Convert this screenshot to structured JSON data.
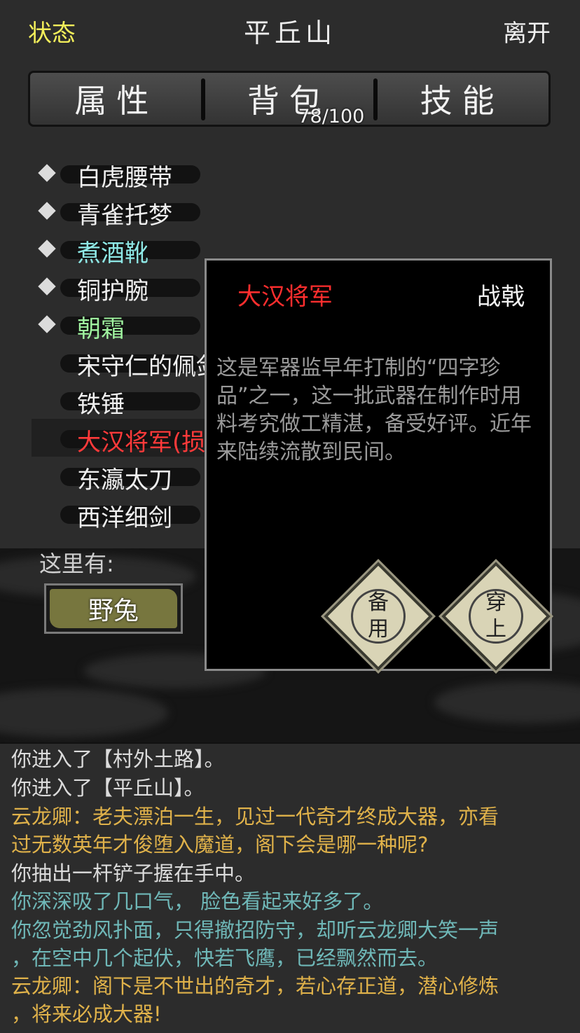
{
  "header": {
    "status_label": "状态",
    "title": "平丘山",
    "leave_label": "离开"
  },
  "tabs": [
    {
      "label": "属性",
      "count": ""
    },
    {
      "label": "背包",
      "count": "78/100"
    },
    {
      "label": "技能",
      "count": ""
    }
  ],
  "inventory": [
    {
      "label": "白虎腰带",
      "equipped": true,
      "color": "white"
    },
    {
      "label": "青雀托梦",
      "equipped": true,
      "color": "white"
    },
    {
      "label": "煮酒靴",
      "equipped": true,
      "color": "cyan"
    },
    {
      "label": "铜护腕",
      "equipped": true,
      "color": "white"
    },
    {
      "label": "朝霜",
      "equipped": true,
      "color": "green"
    },
    {
      "label": "宋守仁的佩剑",
      "equipped": false,
      "color": "white"
    },
    {
      "label": "铁锤",
      "equipped": false,
      "color": "white"
    },
    {
      "label": "大汉将军(损)",
      "equipped": false,
      "color": "red",
      "selected": true
    },
    {
      "label": "东瀛太刀",
      "equipped": false,
      "color": "white"
    },
    {
      "label": "西洋细剑",
      "equipped": false,
      "color": "white"
    }
  ],
  "location": {
    "here_label": "这里有:",
    "npc": "野兔"
  },
  "item_popup": {
    "name": "大汉将军",
    "type": "战戟",
    "description": "这是军器监早年打制的“四字珍品”之一，这一批武器在制作时用料考究做工精湛，备受好评。近年来陆续流散到民间。",
    "buttons": {
      "reserve": [
        "备",
        "用"
      ],
      "equip": [
        "穿",
        "上"
      ]
    }
  },
  "log": [
    {
      "text": "你进入了【村外土路】。",
      "color": "white"
    },
    {
      "text": "你进入了【平丘山】。",
      "color": "white"
    },
    {
      "text": "云龙卿：老夫漂泊一生，见过一代奇才终成大器，亦看",
      "color": "gold"
    },
    {
      "text": "过无数英年才俊堕入魔道，阁下会是哪一种呢?",
      "color": "gold"
    },
    {
      "text": "你抽出一杆铲子握在手中。",
      "color": "white"
    },
    {
      "text": "你深深吸了几口气， 脸色看起来好多了。",
      "color": "teal"
    },
    {
      "text": "你忽觉劲风扑面，只得撤招防守，却听云龙卿大笑一声",
      "color": "teal"
    },
    {
      "text": "，在空中几个起伏，快若飞鹰，已经飘然而去。",
      "color": "teal"
    },
    {
      "text": "云龙卿：阁下是不世出的奇才，若心存正道，潜心修炼",
      "color": "gold"
    },
    {
      "text": "，将来必成大器!",
      "color": "gold"
    }
  ],
  "colors": {
    "status": "#f2ee5a",
    "cyan_item": "#8ee8e6",
    "green_item": "#9ff29f",
    "red_item": "#ff3a3a",
    "log_gold": "#e0b24a",
    "log_teal": "#6fb8b8"
  }
}
